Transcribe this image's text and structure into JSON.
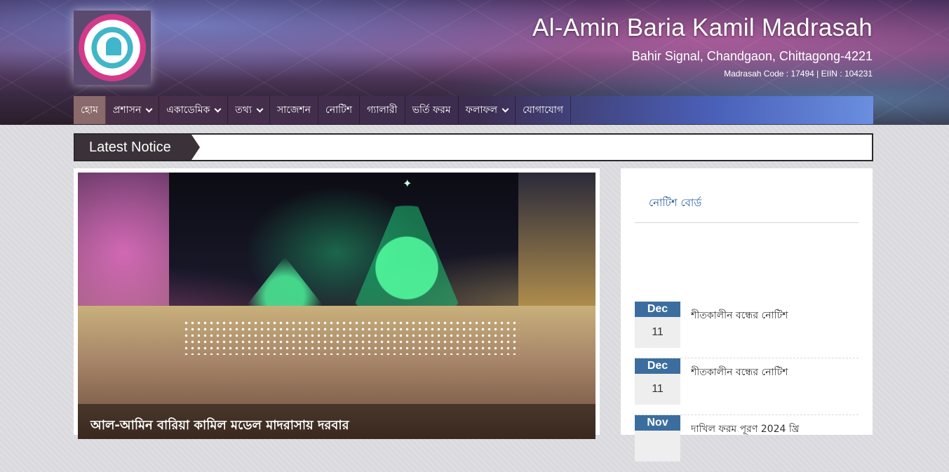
{
  "header": {
    "title": "Al-Amin Baria Kamil Madrasah",
    "address": "Bahir Signal, Chandgaon, Chittagong-4221",
    "code": "Madrasah Code : 17494 | EIIN : 104231"
  },
  "nav": {
    "items": [
      {
        "label": "হোম",
        "dropdown": false
      },
      {
        "label": "প্রশাসন",
        "dropdown": true
      },
      {
        "label": "একাডেমিক",
        "dropdown": true
      },
      {
        "label": "তথ্য",
        "dropdown": true
      },
      {
        "label": "সাজেশন",
        "dropdown": false
      },
      {
        "label": "নোটিশ",
        "dropdown": false
      },
      {
        "label": "গ্যালারী",
        "dropdown": false
      },
      {
        "label": "ভর্তি ফরম",
        "dropdown": false
      },
      {
        "label": "ফলাফল",
        "dropdown": true
      },
      {
        "label": "যোগাযোগ",
        "dropdown": false
      }
    ]
  },
  "latest_notice": {
    "label": "Latest Notice"
  },
  "slider": {
    "caption": "আল-আমিন বারিয়া কামিল মডেল মাদরাসায় দরবার"
  },
  "notice_board": {
    "title": "নোটিশ বোর্ড",
    "items": [
      {
        "month": "Dec",
        "day": "11",
        "text": "শীতকালীন বন্ধের নোটিশ"
      },
      {
        "month": "Dec",
        "day": "11",
        "text": "শীতকালীন বন্ধের নোটিশ"
      },
      {
        "month": "Nov",
        "day": "",
        "text": "দাখিল ফরম পূরণ 2024 খ্রি"
      }
    ]
  },
  "colors": {
    "nav_home_bg": "#8a6a6a",
    "date_month_bg": "#3b6e9f",
    "notice_label_bg": "#3a3238"
  }
}
